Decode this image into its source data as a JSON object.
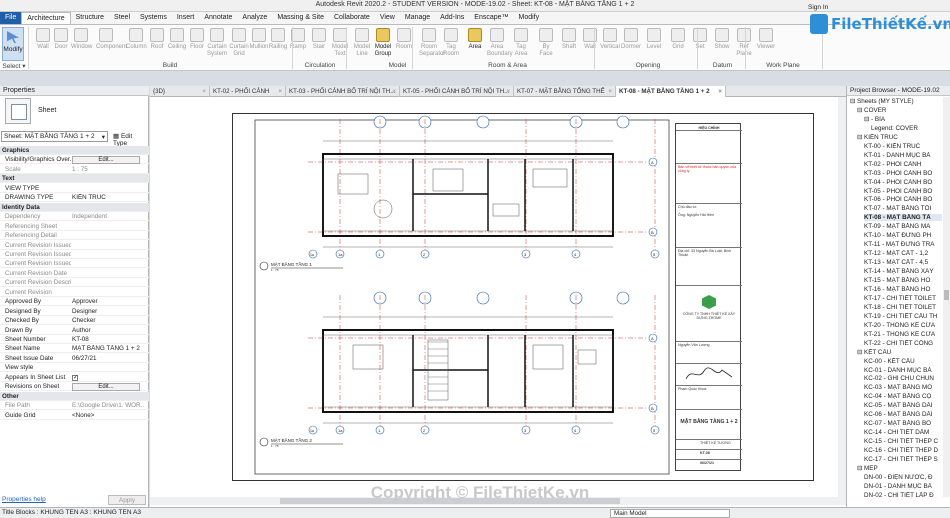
{
  "titlebar": {
    "title": "Autodesk Revit 2020.2 - STUDENT VERSION - MODE-19.02 - Sheet: KT-08 - MẶT BẰNG TẦNG 1 + 2"
  },
  "ribbon": {
    "tabs": [
      "File",
      "Architecture",
      "Structure",
      "Steel",
      "Systems",
      "Insert",
      "Annotate",
      "Analyze",
      "Massing & Site",
      "Collaborate",
      "View",
      "Manage",
      "Add-Ins",
      "Enscape™",
      "Modify"
    ],
    "buttons": [
      "Modify",
      "Wall",
      "Door",
      "Window",
      "Component",
      "Column",
      "Roof",
      "Ceiling",
      "Floor",
      "Curtain System",
      "Curtain Grid",
      "Mullion",
      "Railing",
      "Ramp",
      "Stair",
      "Model Text",
      "Model Line",
      "Model Group",
      "Room",
      "Room Separator",
      "Tag Room",
      "Area",
      "Area Boundary",
      "Tag Area",
      "By Face",
      "Shaft",
      "Wall",
      "Vertical",
      "Dormer",
      "Level",
      "Grid",
      "Set",
      "Show",
      "Ref Plane",
      "Viewer"
    ],
    "groups": [
      "Select",
      "Build",
      "Circulation",
      "Model",
      "Room & Area",
      "Opening",
      "Datum",
      "Work Plane"
    ],
    "select_label": "Select ▾",
    "sign_in": "Sign In"
  },
  "logo": {
    "text": "FileThiếtKế.vn"
  },
  "properties": {
    "header": "Properties",
    "type_name": "Sheet",
    "selector": "Sheet: MẶT BẰNG TẦNG 1 + 2",
    "edit_type": "Edit Type",
    "rows": [
      {
        "k": "Graphics",
        "cat": true
      },
      {
        "k": "Visibility/Graphics Over...",
        "v": "Edit..."
      },
      {
        "k": "Scale",
        "v": "1 : 75",
        "dim": true
      },
      {
        "k": "Text",
        "cat": true
      },
      {
        "k": "VIEW TYPE",
        "v": ""
      },
      {
        "k": "DRAWING TYPE",
        "v": "KIẾN TRÚC"
      },
      {
        "k": "Identity Data",
        "cat": true
      },
      {
        "k": "Dependency",
        "v": "Independent",
        "dim": true
      },
      {
        "k": "Referencing Sheet",
        "v": "",
        "dim": true
      },
      {
        "k": "Referencing Detail",
        "v": "",
        "dim": true
      },
      {
        "k": "Current Revision Issued ...",
        "v": "",
        "dim": true
      },
      {
        "k": "Current Revision Issued ...",
        "v": "",
        "dim": true
      },
      {
        "k": "Current Revision Issued ...",
        "v": "",
        "dim": true
      },
      {
        "k": "Current Revision Date",
        "v": "",
        "dim": true
      },
      {
        "k": "Current Revision Descri...",
        "v": "",
        "dim": true
      },
      {
        "k": "Current Revision",
        "v": "",
        "dim": true
      },
      {
        "k": "Approved By",
        "v": "Approver"
      },
      {
        "k": "Designed By",
        "v": "Designer"
      },
      {
        "k": "Checked By",
        "v": "Checker"
      },
      {
        "k": "Drawn By",
        "v": "Author"
      },
      {
        "k": "Sheet Number",
        "v": "KT-08"
      },
      {
        "k": "Sheet Name",
        "v": "MẶT BẰNG TẦNG 1 + 2"
      },
      {
        "k": "Sheet Issue Date",
        "v": "06/27/21"
      },
      {
        "k": "View style",
        "v": ""
      },
      {
        "k": "Appears In Sheet List",
        "v": "✓"
      },
      {
        "k": "Revisions on Sheet",
        "v": "Edit..."
      },
      {
        "k": "Other",
        "cat": true
      },
      {
        "k": "File Path",
        "v": "E:\\Google Drive\\1. WOR...",
        "dim": true
      },
      {
        "k": "Guide Grid",
        "v": "<None>"
      }
    ],
    "help": "Properties help",
    "apply": "Apply"
  },
  "view_tabs": [
    {
      "label": "{3D}",
      "w": 60
    },
    {
      "label": "KT-02 - PHỐI CẢNH",
      "w": 76
    },
    {
      "label": "KT-03 - PHỐI CẢNH BỐ TRÍ NỘI TH...",
      "w": 114
    },
    {
      "label": "KT-05 - PHỐI CẢNH BỐ TRÍ NỘI TH...",
      "w": 114
    },
    {
      "label": "KT-07 - MẶT BẰNG TỔNG THỂ",
      "w": 102
    },
    {
      "label": "KT-08 - MẶT BẰNG TẦNG 1 + 2",
      "w": 110,
      "active": true
    }
  ],
  "sheet": {
    "title_block": {
      "revision": "HIỆU CHỈNH",
      "notes_red": "Bản vẽ thiết kế thuộc bản quyền của công ty",
      "client_label": "Chủ đầu tư:",
      "client": "Ông: Nguyễn Hải Hiền",
      "address": "Địa chỉ: 33 Nguyễn Bá Luật, Bình Thuận",
      "company": "CÔNG TY TNHH THIẾT KẾ XÂY DỰNG ZHOME",
      "designer": "Nguyễn Văn Lương",
      "checker": "Phạm Quốc Khoa",
      "sheet_title": "MẶT BẰNG TẦNG 1 + 2",
      "project": "THIẾT KẾ TƯƠNG",
      "sheet_no": "KT-08",
      "date": "06/27/21"
    },
    "plan_labels": [
      "MẶT BẰNG TẦNG 1",
      "MẶT BẰNG TẦNG 2"
    ],
    "plan_scale": "1 : 75",
    "grid_labels": [
      "1a",
      "1",
      "2",
      "3",
      "4",
      "5",
      "6"
    ],
    "grid_rows": [
      "A",
      "B",
      "C"
    ]
  },
  "project_browser": {
    "header": "Project Browser - MODE-19.02",
    "items": [
      {
        "t": "⊟ Sheets (MY STYLE)",
        "l": 0
      },
      {
        "t": "⊟ COVER",
        "l": 1
      },
      {
        "t": "⊟ - BÌA",
        "l": 2
      },
      {
        "t": "Legend: COVER",
        "l": 3
      },
      {
        "t": "⊟ KIẾN TRÚC",
        "l": 1
      },
      {
        "t": "KT-00 - KIẾN TRÚC",
        "l": 2
      },
      {
        "t": "KT-01 - DANH MỤC BẢ",
        "l": 2
      },
      {
        "t": "KT-02 - PHỐI CẢNH",
        "l": 2
      },
      {
        "t": "KT-03 - PHỐI CẢNH BỐ",
        "l": 2
      },
      {
        "t": "KT-04 - PHỐI CẢNH BỐ",
        "l": 2
      },
      {
        "t": "KT-05 - PHỐI CẢNH BỐ",
        "l": 2
      },
      {
        "t": "KT-06 - PHỐI CẢNH BỐ",
        "l": 2
      },
      {
        "t": "KT-07 - MẶT BẰNG TỔI",
        "l": 2
      },
      {
        "t": "KT-08 - MẶT BẰNG TẦ",
        "l": 2,
        "bold": true
      },
      {
        "t": "KT-09 - MẶT BẰNG MÁ",
        "l": 2
      },
      {
        "t": "KT-10 - MẶT ĐỨNG PH",
        "l": 2
      },
      {
        "t": "KT-11 - MẶT ĐỨNG TRA",
        "l": 2
      },
      {
        "t": "KT-12 - MẶT CẮT - 1,2",
        "l": 2
      },
      {
        "t": "KT-13 - MẶT CẮT - 4,5",
        "l": 2
      },
      {
        "t": "KT-14 - MẶT BẰNG XÂY",
        "l": 2
      },
      {
        "t": "KT-15 - MẶT BẰNG HO",
        "l": 2
      },
      {
        "t": "KT-16 - MẶT BẰNG HO",
        "l": 2
      },
      {
        "t": "KT-17 - CHI TIẾT TOILET",
        "l": 2
      },
      {
        "t": "KT-18 - CHI TIẾT TOILET",
        "l": 2
      },
      {
        "t": "KT-19 - CHI TIẾT CẦU TH",
        "l": 2
      },
      {
        "t": "KT-20 - THỐNG KÊ CỬA",
        "l": 2
      },
      {
        "t": "KT-21 - THỐNG KÊ CỬA",
        "l": 2
      },
      {
        "t": "KT-22 - CHI TIẾT CỔNG",
        "l": 2
      },
      {
        "t": "⊟ KẾT CẤU",
        "l": 1
      },
      {
        "t": "KC-00 - KẾT CẤU",
        "l": 2
      },
      {
        "t": "KC-01 - DANH MỤC BẢ",
        "l": 2
      },
      {
        "t": "KC-02 - GHI CHÚ CHUN",
        "l": 2
      },
      {
        "t": "KC-03 - MẶT BẰNG MÓ",
        "l": 2
      },
      {
        "t": "KC-04 - MẶT BẰNG CỘ",
        "l": 2
      },
      {
        "t": "KC-05 - MẶT BẰNG DẦI",
        "l": 2
      },
      {
        "t": "KC-06 - MẶT BẰNG DẦI",
        "l": 2
      },
      {
        "t": "KC-07 - MẶT BẰNG BỐ",
        "l": 2
      },
      {
        "t": "KC-14 - CHI TIẾT DẦM",
        "l": 2
      },
      {
        "t": "KC-15 - CHI TIẾT THÉP C",
        "l": 2
      },
      {
        "t": "KC-16 - CHI TIẾT THÉP D",
        "l": 2
      },
      {
        "t": "KC-17 - CHI TIẾT THÉP S",
        "l": 2
      },
      {
        "t": "⊟ MEP",
        "l": 1
      },
      {
        "t": "DN-00 - ĐIỆN NƯỚC, Đ",
        "l": 2
      },
      {
        "t": "DN-01 - DANH MỤC BẢ",
        "l": 2
      },
      {
        "t": "DN-02 - CHI TIẾT LẮP Đ",
        "l": 2
      }
    ]
  },
  "status": {
    "left": "Title Blocks : KHUNG TEN A3 : KHUNG TEN A3",
    "model": "Main Model"
  },
  "watermark": "Copyright © FileThietKe.vn",
  "colors": {
    "accent": "#1f5fa8",
    "logo": "#2f8fd6",
    "grid_bubble": "#2a5fb0",
    "red": "#d22222"
  }
}
